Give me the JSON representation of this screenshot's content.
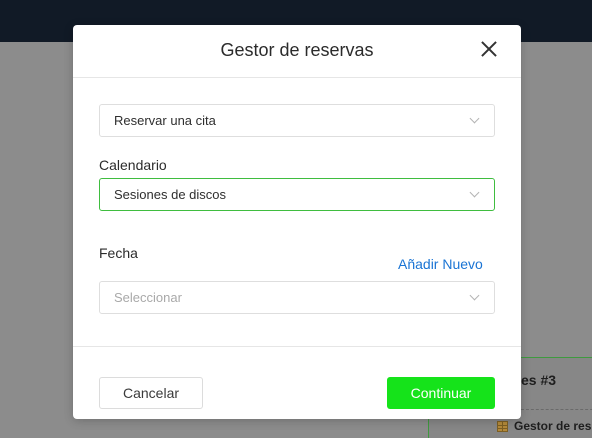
{
  "background": {
    "card_title": "es #3",
    "card_row_label": "Gestor de res"
  },
  "modal": {
    "title": "Gestor de reservas",
    "close_icon": "close-icon",
    "booking_type": {
      "value": "Reservar una cita"
    },
    "calendar": {
      "label": "Calendario",
      "value": "Sesiones de discos"
    },
    "date": {
      "label": "Fecha",
      "add_new_label": "Añadir Nuevo",
      "placeholder": "Seleccionar"
    },
    "cancel_label": "Cancelar",
    "continue_label": "Continuar"
  },
  "colors": {
    "accent_green": "#15e31a",
    "link_blue": "#1a74d4",
    "topbar": "#111a26"
  }
}
